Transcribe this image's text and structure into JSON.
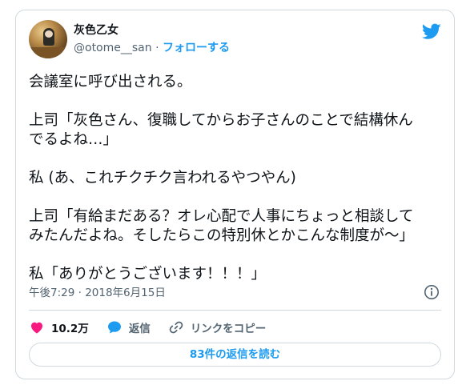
{
  "user": {
    "display_name": "灰色乙女",
    "handle": "@otome__san",
    "separator": " · ",
    "follow_label": "フォローする"
  },
  "tweet": {
    "text": "会議室に呼び出される。\n\n上司「灰色さん、復職してからお子さんのことで結構休ん\nでるよね…」\n\n私 (あ、これチクチク言われるやつやん)\n\n上司「有給まだある？オレ心配で人事にちょっと相談して\nみたんだよね。そしたらこの特別休とかこんな制度が～」\n\n私「ありがとうございます！！！」",
    "timestamp": "午後7:29 · 2018年6月15日"
  },
  "actions": {
    "like_count": "10.2万",
    "reply_label": "返信",
    "copy_link_label": "リンクをコピー"
  },
  "read_replies_label": "83件の返信を読む",
  "colors": {
    "accent": "#1d9bf0",
    "like": "#f91880",
    "muted": "#536471",
    "border": "#cfd9de"
  },
  "icons": [
    "twitter-bird-icon",
    "info-icon",
    "heart-icon",
    "reply-bubble-icon",
    "link-icon"
  ]
}
